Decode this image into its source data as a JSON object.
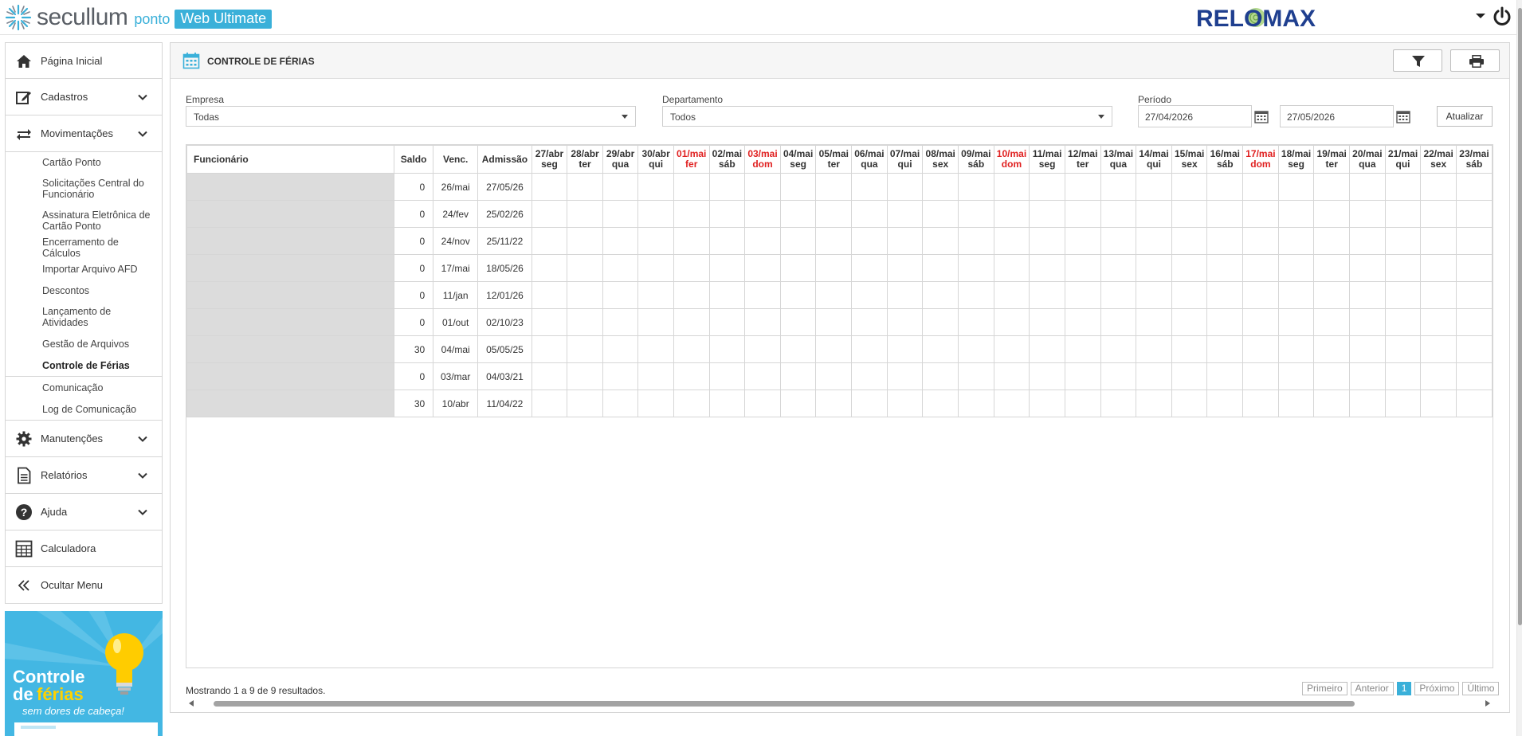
{
  "brand": {
    "name": "secullum",
    "product": "ponto",
    "edition": "Web Ultimate",
    "partner": "RELOMAX"
  },
  "sidebar": {
    "items": [
      {
        "label": "Página Inicial",
        "icon": "home-icon"
      },
      {
        "label": "Cadastros",
        "icon": "edit-icon"
      },
      {
        "label": "Movimentações",
        "icon": "transfer-icon"
      }
    ],
    "movimentacoes_sub": [
      "Cartão Ponto",
      "Solicitações Central do Funcionário",
      "Assinatura Eletrônica de Cartão Ponto",
      "Encerramento de Cálculos",
      "Importar Arquivo AFD",
      "Descontos",
      "Lançamento de Atividades",
      "Gestão de Arquivos",
      "Controle de Férias",
      "Comunicação",
      "Log de Comunicação"
    ],
    "items_after": [
      {
        "label": "Manutenções",
        "icon": "gear-icon"
      },
      {
        "label": "Relatórios",
        "icon": "report-icon"
      },
      {
        "label": "Ajuda",
        "icon": "help-icon"
      },
      {
        "label": "Calculadora",
        "icon": "calculator-icon"
      },
      {
        "label": "Ocultar Menu",
        "icon": "double-chevron-left-icon"
      }
    ],
    "promo": {
      "line1": "Controle",
      "line2a": "de ",
      "line2b": "férias",
      "line3": "sem dores de cabeça!"
    }
  },
  "panel": {
    "title": "CONTROLE DE FÉRIAS",
    "filters": {
      "empresa_label": "Empresa",
      "empresa_value": "Todas",
      "departamento_label": "Departamento",
      "departamento_value": "Todos",
      "periodo_label": "Período",
      "periodo_inicio": "27/04/2026",
      "periodo_fim": "27/05/2026",
      "atualizar": "Atualizar"
    },
    "table": {
      "col_funcionario": "Funcionário",
      "col_saldo": "Saldo",
      "col_venc": "Venc.",
      "col_admissao": "Admissão",
      "days": [
        {
          "d": "27/abr",
          "w": "seg",
          "hol": false
        },
        {
          "d": "28/abr",
          "w": "ter",
          "hol": false
        },
        {
          "d": "29/abr",
          "w": "qua",
          "hol": false
        },
        {
          "d": "30/abr",
          "w": "qui",
          "hol": false
        },
        {
          "d": "01/mai",
          "w": "fer",
          "hol": true
        },
        {
          "d": "02/mai",
          "w": "sáb",
          "hol": false
        },
        {
          "d": "03/mai",
          "w": "dom",
          "hol": true
        },
        {
          "d": "04/mai",
          "w": "seg",
          "hol": false
        },
        {
          "d": "05/mai",
          "w": "ter",
          "hol": false
        },
        {
          "d": "06/mai",
          "w": "qua",
          "hol": false
        },
        {
          "d": "07/mai",
          "w": "qui",
          "hol": false
        },
        {
          "d": "08/mai",
          "w": "sex",
          "hol": false
        },
        {
          "d": "09/mai",
          "w": "sáb",
          "hol": false
        },
        {
          "d": "10/mai",
          "w": "dom",
          "hol": true
        },
        {
          "d": "11/mai",
          "w": "seg",
          "hol": false
        },
        {
          "d": "12/mai",
          "w": "ter",
          "hol": false
        },
        {
          "d": "13/mai",
          "w": "qua",
          "hol": false
        },
        {
          "d": "14/mai",
          "w": "qui",
          "hol": false
        },
        {
          "d": "15/mai",
          "w": "sex",
          "hol": false
        },
        {
          "d": "16/mai",
          "w": "sáb",
          "hol": false
        },
        {
          "d": "17/mai",
          "w": "dom",
          "hol": true
        },
        {
          "d": "18/mai",
          "w": "seg",
          "hol": false
        },
        {
          "d": "19/mai",
          "w": "ter",
          "hol": false
        },
        {
          "d": "20/mai",
          "w": "qua",
          "hol": false
        },
        {
          "d": "21/mai",
          "w": "qui",
          "hol": false
        },
        {
          "d": "22/mai",
          "w": "sex",
          "hol": false
        },
        {
          "d": "23/mai",
          "w": "sáb",
          "hol": false
        }
      ],
      "rows": [
        {
          "saldo": "0",
          "venc": "26/mai",
          "admissao": "27/05/26",
          "cells": "ggggggggggggggggggggggggggg"
        },
        {
          "saldo": "0",
          "venc": "24/fev",
          "admissao": "25/02/26",
          "cells": "wwwwwwwwwwwwwwwwwwwwwwwwwww"
        },
        {
          "saldo": "0",
          "venc": "24/nov",
          "admissao": "25/11/22",
          "cells": "wwwwwwwvvvvvvvvvvvvvvvvvvvv"
        },
        {
          "saldo": "0",
          "venc": "17/mai",
          "admissao": "18/05/26",
          "cells": "gggggggggggggggggggggwwwwww"
        },
        {
          "saldo": "0",
          "venc": "11/jan",
          "admissao": "12/01/26",
          "cells": "wwwwwwwwwwwwwwwwwwwwwwwwwww"
        },
        {
          "saldo": "0",
          "venc": "01/out",
          "admissao": "02/10/23",
          "cells": "wwwwwwwwwwwwwwwwwwwwwwwwwww"
        },
        {
          "saldo": "30",
          "venc": "04/mai",
          "admissao": "05/05/25",
          "cells": "wwwwwwwwwwwwwwwwwwwwwwwwwww"
        },
        {
          "saldo": "0",
          "venc": "03/mar",
          "admissao": "04/03/21",
          "cells": "wwwwwwwwwwwwwwwwwwwwwwwwwww"
        },
        {
          "saldo": "30",
          "venc": "10/abr",
          "admissao": "11/04/22",
          "cells": "wwwwwwwwwwwwwwwwwwwwwwwwwww"
        }
      ]
    },
    "footer": {
      "results": "Mostrando 1 a 9 de 9 resultados.",
      "pager": {
        "first": "Primeiro",
        "prev": "Anterior",
        "current": "1",
        "next": "Próximo",
        "last": "Último"
      }
    }
  },
  "colors": {
    "accent": "#3ab0d9",
    "vacation": "#a8f5a0",
    "inactive": "#dcdcdc",
    "holiday": "#e02020"
  }
}
